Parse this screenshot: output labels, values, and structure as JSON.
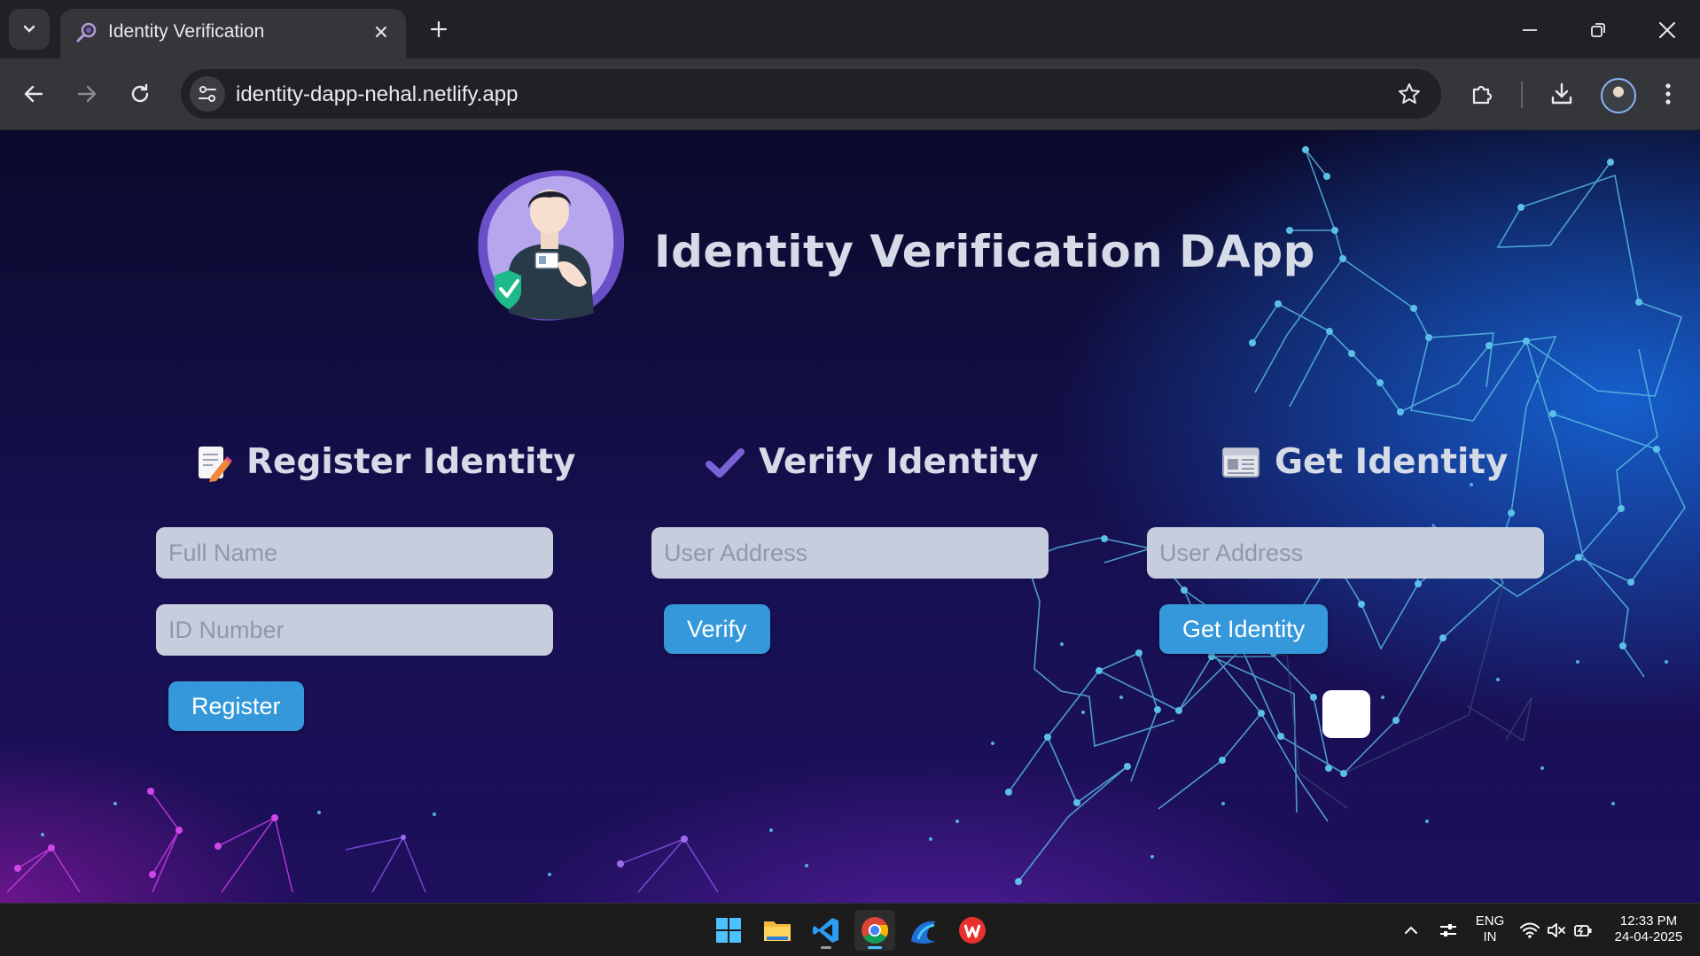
{
  "browser": {
    "tab_title": "Identity Verification",
    "url": "identity-dapp-nehal.netlify.app"
  },
  "page": {
    "title": "Identity Verification DApp",
    "register": {
      "heading": "Register Identity",
      "name_placeholder": "Full Name",
      "id_placeholder": "ID Number",
      "button": "Register"
    },
    "verify": {
      "heading": "Verify Identity",
      "address_placeholder": "User Address",
      "button": "Verify"
    },
    "get": {
      "heading": "Get Identity",
      "address_placeholder": "User Address",
      "button": "Get Identity"
    }
  },
  "taskbar": {
    "apps": [
      "start-icon",
      "file-explorer-icon",
      "vscode-icon",
      "chrome-icon",
      "edge-icon",
      "wps-office-icon"
    ],
    "lang_line1": "ENG",
    "lang_line2": "IN",
    "time": "12:33 PM",
    "date": "24-04-2025"
  },
  "colors": {
    "accent_button": "#3498db",
    "input_bg": "#c6cddd",
    "heading": "#d6dbe8"
  }
}
